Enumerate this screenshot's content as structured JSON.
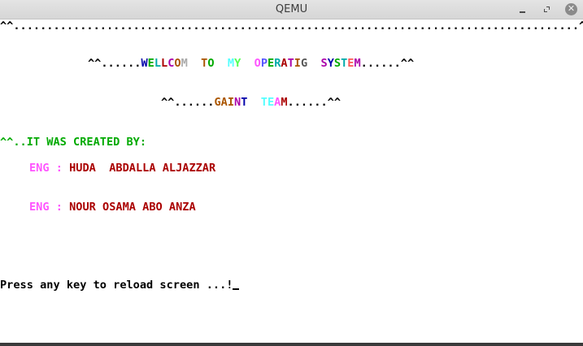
{
  "window": {
    "title": "QEMU"
  },
  "screen": {
    "border": "^^.....................................................................................^^",
    "welcome": {
      "pre": "^^......",
      "words": [
        {
          "text": "W",
          "color": "#0000aa"
        },
        {
          "text": "E",
          "color": "#00aa00"
        },
        {
          "text": "L",
          "color": "#00aaaa"
        },
        {
          "text": "L",
          "color": "#aa0000"
        },
        {
          "text": "C",
          "color": "#aa00aa"
        },
        {
          "text": "O",
          "color": "#aa5500"
        },
        {
          "text": "M",
          "color": "#aaaaaa"
        },
        {
          "text": "  ",
          "color": "#000000"
        },
        {
          "text": "T",
          "color": "#aa5500"
        },
        {
          "text": "O",
          "color": "#00aa00"
        },
        {
          "text": "  ",
          "color": "#000000"
        },
        {
          "text": "M",
          "color": "#55ffff"
        },
        {
          "text": "Y",
          "color": "#55ff55"
        },
        {
          "text": "  ",
          "color": "#000000"
        },
        {
          "text": "O",
          "color": "#ff55ff"
        },
        {
          "text": "P",
          "color": "#5555ff"
        },
        {
          "text": "E",
          "color": "#00aa00"
        },
        {
          "text": "R",
          "color": "#00aaaa"
        },
        {
          "text": "A",
          "color": "#aa0000"
        },
        {
          "text": "T",
          "color": "#aa00aa"
        },
        {
          "text": "I",
          "color": "#aa5500"
        },
        {
          "text": "G",
          "color": "#555555"
        },
        {
          "text": "  ",
          "color": "#000000"
        },
        {
          "text": "S",
          "color": "#aa00aa"
        },
        {
          "text": "Y",
          "color": "#0000aa"
        },
        {
          "text": "S",
          "color": "#00aa00"
        },
        {
          "text": "T",
          "color": "#00aaaa"
        },
        {
          "text": "E",
          "color": "#ff5555"
        },
        {
          "text": "M",
          "color": "#aa00aa"
        }
      ],
      "post": "......^^"
    },
    "team": {
      "pre": "^^......",
      "words": [
        {
          "text": "G",
          "color": "#aa5500"
        },
        {
          "text": "A",
          "color": "#aa5500"
        },
        {
          "text": "I",
          "color": "#aa5500"
        },
        {
          "text": "N",
          "color": "#aa00aa"
        },
        {
          "text": "T",
          "color": "#0000aa"
        },
        {
          "text": "  ",
          "color": "#000000"
        },
        {
          "text": "T",
          "color": "#55ffff"
        },
        {
          "text": "E",
          "color": "#55ffff"
        },
        {
          "text": "A",
          "color": "#ff55ff"
        },
        {
          "text": "M",
          "color": "#aa0000"
        }
      ],
      "post": "......^^"
    },
    "created_by": "^^..IT WAS CREATED BY:",
    "authors": [
      {
        "prefix": "ENG",
        "sep": " : ",
        "name": "HUDA  ABDALLA ALJAZZAR"
      },
      {
        "prefix": "ENG",
        "sep": " : ",
        "name": "NOUR OSAMA ABO ANZA"
      }
    ],
    "prompt": "Press any key to reload screen ...!"
  },
  "colors": {
    "created_by": "#00aa00",
    "author_prefix": "#ff55ff",
    "author_sep": "#ff55ff",
    "author_name": "#aa0000",
    "prompt": "#000000"
  }
}
